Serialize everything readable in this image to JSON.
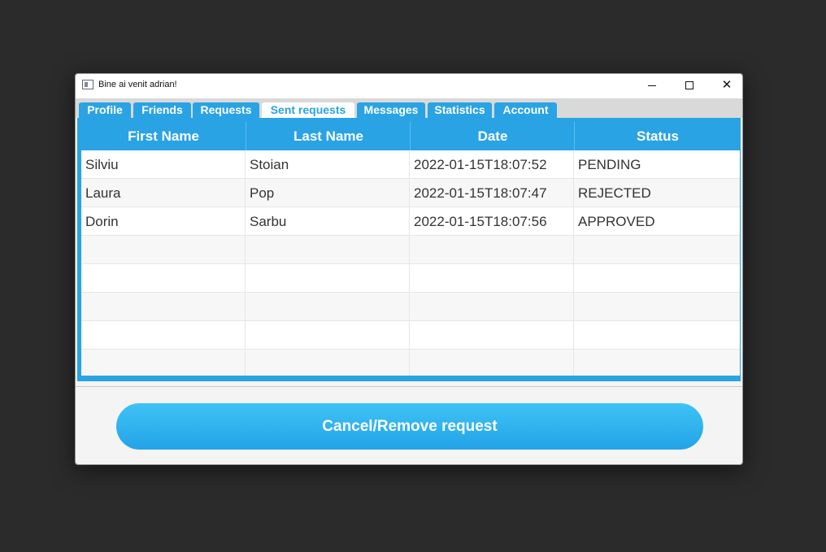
{
  "window": {
    "title": "Bine ai venit adrian!"
  },
  "tabs": [
    {
      "label": "Profile",
      "selected": false
    },
    {
      "label": "Friends",
      "selected": false
    },
    {
      "label": "Requests",
      "selected": false
    },
    {
      "label": "Sent requests",
      "selected": true
    },
    {
      "label": "Messages",
      "selected": false
    },
    {
      "label": "Statistics",
      "selected": false
    },
    {
      "label": "Account",
      "selected": false
    }
  ],
  "table": {
    "columns": [
      "First Name",
      "Last Name",
      "Date",
      "Status"
    ],
    "rows": [
      [
        "Silviu",
        "Stoian",
        "2022-01-15T18:07:52",
        "PENDING"
      ],
      [
        "Laura",
        "Pop",
        "2022-01-15T18:07:47",
        "REJECTED"
      ],
      [
        "Dorin",
        "Sarbu",
        "2022-01-15T18:07:56",
        "APPROVED"
      ]
    ],
    "empty_row_count": 5
  },
  "actions": {
    "cancel_remove_label": "Cancel/Remove request"
  },
  "colors": {
    "accent": "#2aa3e4",
    "window_bg": "#f4f4f4",
    "desktop_bg": "#2b2b2b"
  }
}
